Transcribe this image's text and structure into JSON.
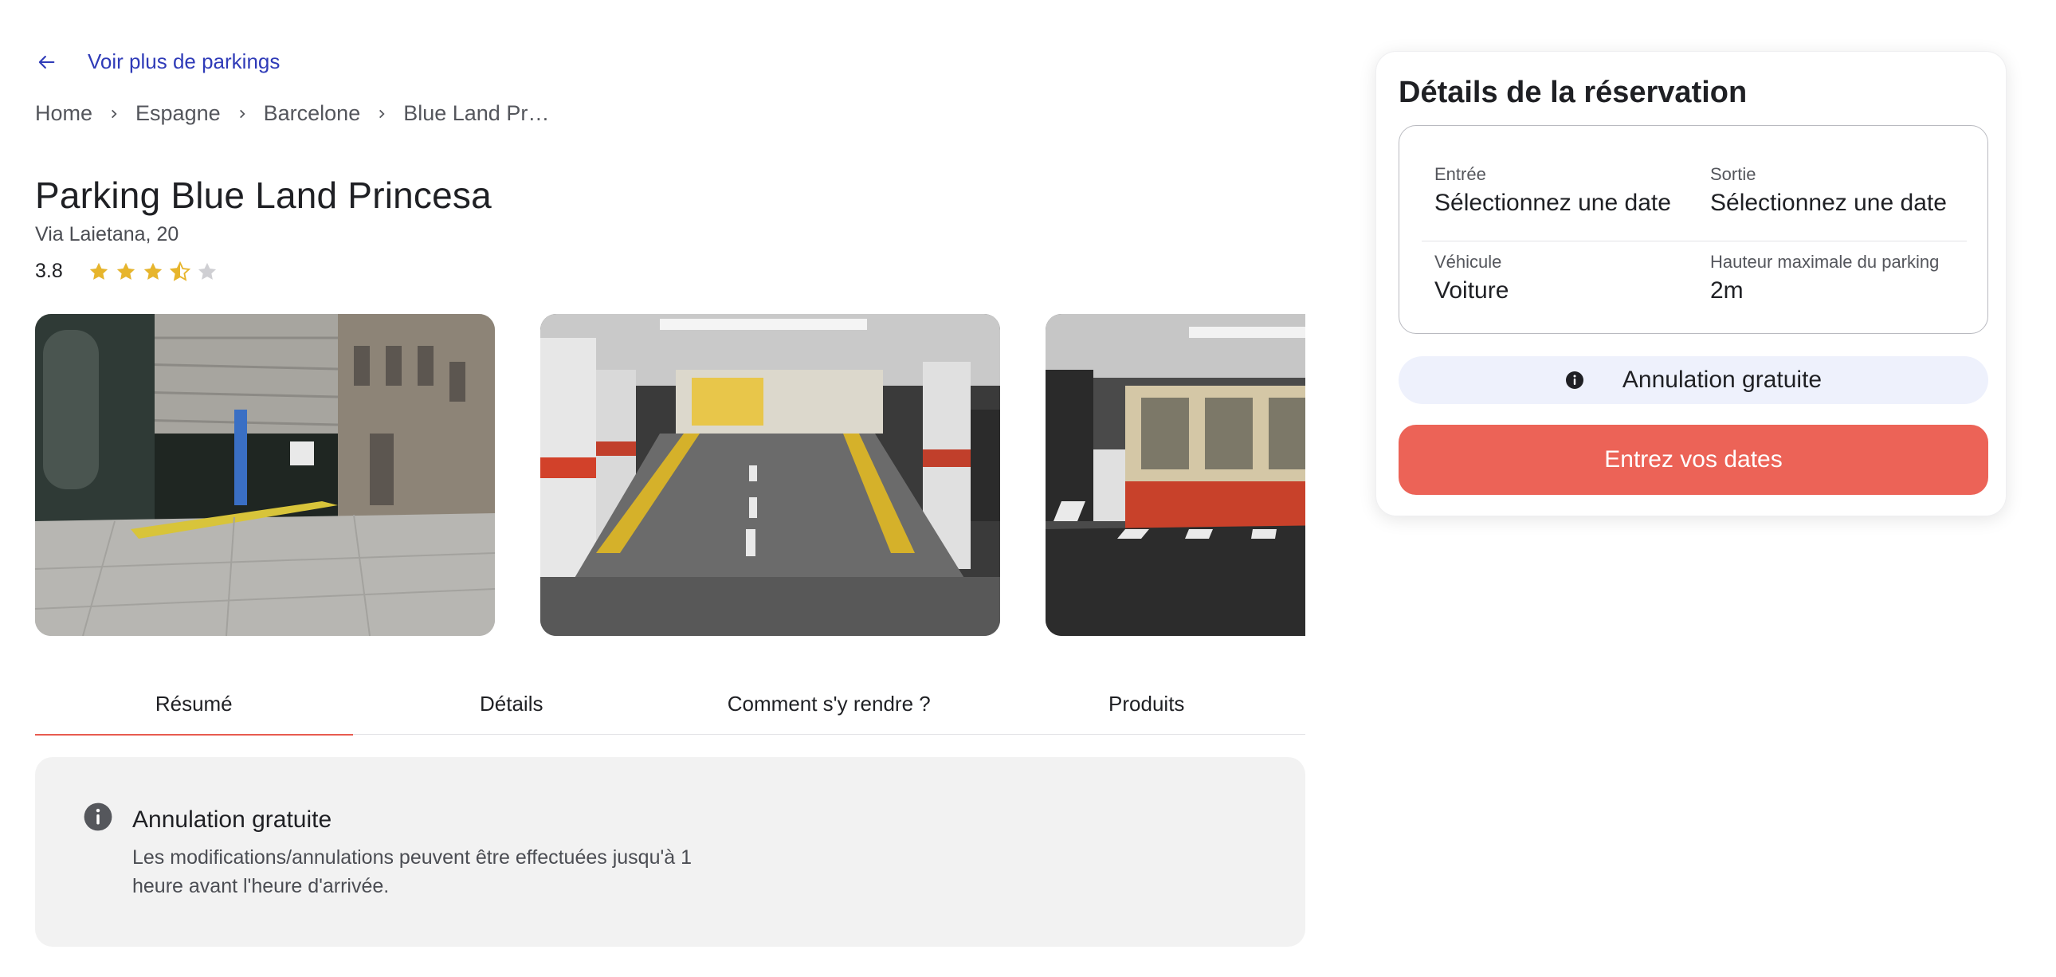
{
  "nav": {
    "back_label": "Voir plus de parkings"
  },
  "breadcrumb": {
    "items": [
      "Home",
      "Espagne",
      "Barcelone",
      "Blue Land Princesa"
    ]
  },
  "listing": {
    "title": "Parking Blue Land Princesa",
    "address": "Via Laietana, 20",
    "rating": "3.8",
    "rating_value": 3.5,
    "rating_max": 5
  },
  "gallery": {
    "photos": [
      "parking-entrance-photo",
      "parking-ramp-photo",
      "parking-office-photo"
    ]
  },
  "tabs": [
    "Résumé",
    "Détails",
    "Comment s'y rendre ?",
    "Produits"
  ],
  "active_tab": 0,
  "info_card": {
    "icon": "info-icon",
    "title": "Annulation gratuite",
    "body": "Les modifications/annulations peuvent être effectuées jusqu'à 1 heure avant l'heure d'arrivée."
  },
  "reservation": {
    "title": "Détails de la réservation",
    "entry_label": "Entrée",
    "entry_value": "Sélectionnez une date",
    "exit_label": "Sortie",
    "exit_value": "Sélectionnez une date",
    "vehicle_label": "Véhicule",
    "vehicle_value": "Voiture",
    "height_label": "Hauteur maximale du parking",
    "height_value": "2m",
    "cancellation_label": "Annulation gratuite",
    "cta_label": "Entrez vos dates"
  },
  "colors": {
    "link": "#2f3bb8",
    "accent": "#ec6357",
    "star": "#e7b52c",
    "star_empty": "#cfcfd3",
    "pill_bg": "#eef1fc",
    "card_bg": "#f2f2f2"
  }
}
